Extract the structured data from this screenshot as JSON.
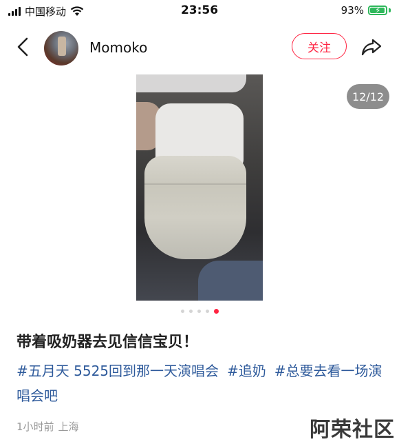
{
  "status_bar": {
    "carrier": "中国移动",
    "time": "23:56",
    "battery_percent": "93%",
    "battery_level": 0.93,
    "icons": [
      "signal-icon",
      "wifi-icon",
      "battery-charging-icon"
    ]
  },
  "header": {
    "username": "Momoko",
    "follow_label": "关注",
    "icons": [
      "back-icon",
      "share-icon"
    ]
  },
  "carousel": {
    "counter": "12/12",
    "total_dots": 5,
    "active_dot": 5
  },
  "post": {
    "title": "带着吸奶器去见信信宝贝！",
    "tags": [
      "#五月天 5525回到那一天演唱会",
      "#追奶",
      "#总要去看一场演唱会吧"
    ],
    "time": "1小时前",
    "location": "上海"
  },
  "watermark": "阿荣社区",
  "colors": {
    "accent": "#ff2442",
    "tag": "#2e5a9b",
    "battery": "#2fb85c"
  }
}
